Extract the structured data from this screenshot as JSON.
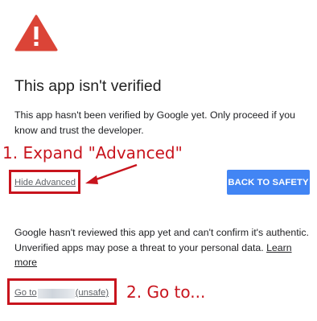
{
  "icon": {
    "name": "warning-triangle-icon",
    "color": "#db4437"
  },
  "title": "This app isn't verified",
  "description": "This app hasn't been verified by Google yet. Only proceed if you know and trust the developer.",
  "annotation_1": "1. Expand \"Advanced\"",
  "annotation_2": "2. Go to...",
  "hide_advanced_label": "Hide Advanced",
  "back_to_safety_label": "BACK TO SAFETY",
  "advanced_text": "Google hasn't reviewed this app yet and can't confirm it's authentic. Unverified apps may pose a threat to your personal data.",
  "learn_more_label": "Learn more",
  "goto": {
    "prefix": "Go to",
    "suffix": "(unsafe)"
  },
  "colors": {
    "annotation": "#c8141d",
    "button": "#4285f4",
    "link": "#5f6368"
  }
}
